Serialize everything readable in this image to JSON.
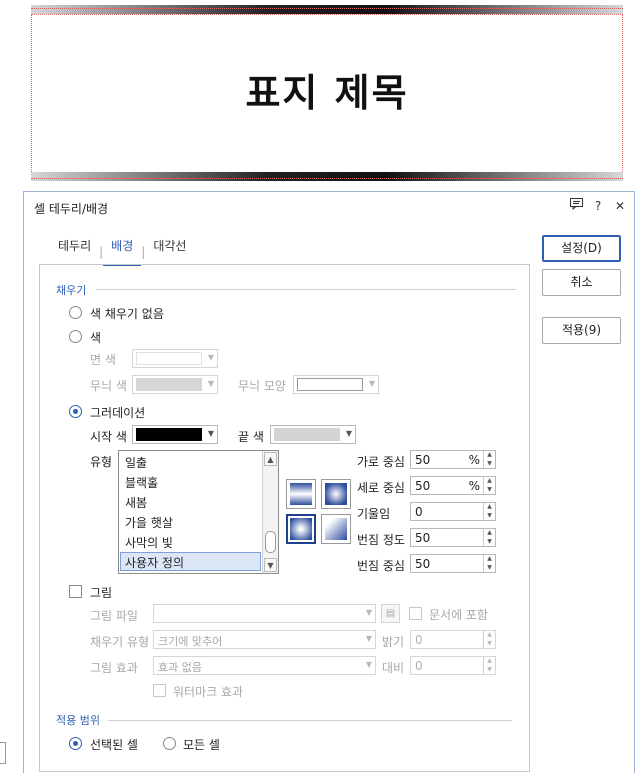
{
  "document": {
    "title": "표지 제목"
  },
  "dialog": {
    "title": "셀 테두리/배경",
    "tabs": [
      "테두리",
      "배경",
      "대각선"
    ],
    "active_tab": "배경",
    "buttons": {
      "ok": "설정(D)",
      "cancel": "취소",
      "apply": "적용(9)"
    },
    "fill": {
      "section": "채우기",
      "no_fill": "색 채우기 없음",
      "color": "색",
      "face_color": "면 색",
      "pattern_color": "무늬 색",
      "pattern_shape": "무늬 모양",
      "gradient": "그러데이션",
      "start_color": "시작 색",
      "end_color": "끝 색",
      "type_label": "유형",
      "types": [
        "일출",
        "블랙홀",
        "새봄",
        "가을 햇살",
        "사막의 빛",
        "사용자 정의"
      ],
      "selected_type": "사용자 정의",
      "center_x_label": "가로 중심",
      "center_x": "50",
      "center_x_unit": "%",
      "center_y_label": "세로 중심",
      "center_y": "50",
      "center_y_unit": "%",
      "tilt_label": "기울임",
      "tilt": "0",
      "blur_label": "번짐 정도",
      "blur": "50",
      "blur_center_label": "번짐 중심",
      "blur_center": "50",
      "start_color_value": "#000000",
      "end_color_value": "#d4d4d4"
    },
    "picture": {
      "label": "그림",
      "file_label": "그림 파일",
      "include_in_doc": "문서에 포함",
      "fill_type_label": "채우기 유형",
      "fill_type": "크기에 맞추어",
      "brightness_label": "밝기",
      "brightness": "0",
      "effect_label": "그림 효과",
      "effect": "효과 없음",
      "contrast_label": "대비",
      "contrast": "0",
      "watermark": "워터마크 효과"
    },
    "scope": {
      "section": "적용 범위",
      "selected_cells": "선택된 셀",
      "all_cells": "모든 셀"
    }
  }
}
